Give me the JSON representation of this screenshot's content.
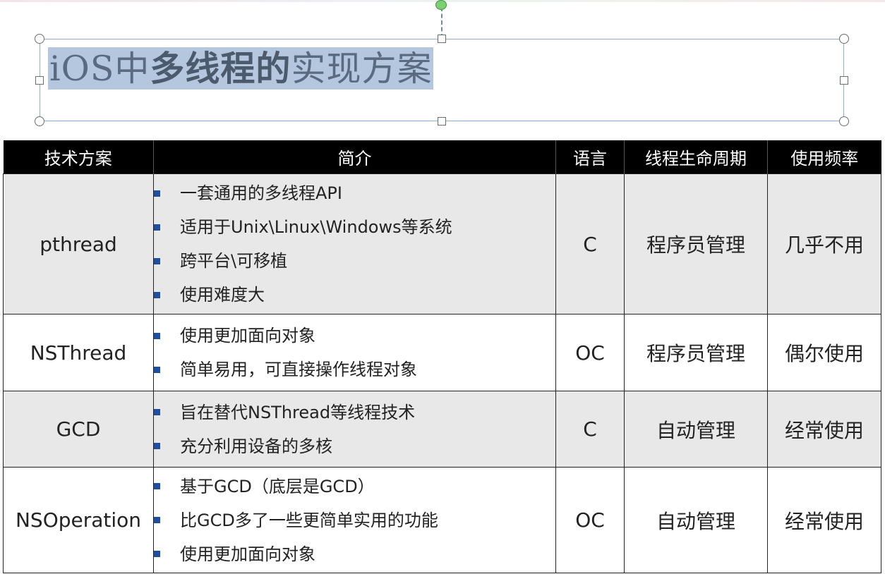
{
  "title": {
    "prefix": "iOS中",
    "bold": "多线程的",
    "suffix": "实现方案"
  },
  "colors": {
    "header_bg": "#000000",
    "row_shade": "#e8e8e8",
    "bullet": "#1e4fa3",
    "highlight_red": "#e60000",
    "title_selection": "#b5c7de"
  },
  "table": {
    "headers": [
      "技术方案",
      "简介",
      "语言",
      "线程生命周期",
      "使用频率"
    ],
    "rows": [
      {
        "name": "pthread",
        "intro": [
          "一套通用的多线程API",
          "适用于Unix\\Linux\\Windows等系统",
          "跨平台\\可移植",
          "使用难度大"
        ],
        "language": "C",
        "lifecycle": "程序员管理",
        "frequency": "几乎不用",
        "frequency_highlight": false
      },
      {
        "name": "NSThread",
        "intro": [
          "使用更加面向对象",
          "简单易用，可直接操作线程对象"
        ],
        "language": "OC",
        "lifecycle": "程序员管理",
        "frequency": "偶尔使用",
        "frequency_highlight": false
      },
      {
        "name": "GCD",
        "intro": [
          "旨在替代NSThread等线程技术",
          "充分利用设备的多核"
        ],
        "language": "C",
        "lifecycle": "自动管理",
        "frequency": "经常使用",
        "frequency_highlight": true
      },
      {
        "name": "NSOperation",
        "intro": [
          "基于GCD（底层是GCD）",
          "比GCD多了一些更简单实用的功能",
          "使用更加面向对象"
        ],
        "language": "OC",
        "lifecycle": "自动管理",
        "frequency": "经常使用",
        "frequency_highlight": true
      }
    ]
  }
}
